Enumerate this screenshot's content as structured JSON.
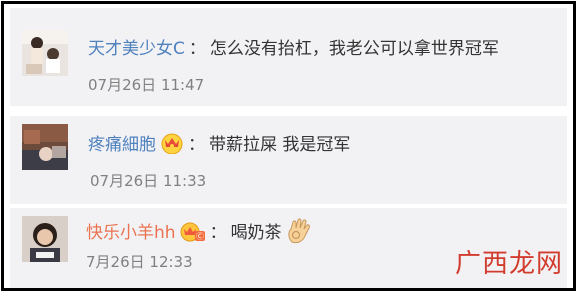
{
  "comments": [
    {
      "user": "天才美少女C",
      "separator": "：",
      "text": "怎么没有抬杠，我老公可以拿世界冠军",
      "time": "07月26日 11:47",
      "badge": null
    },
    {
      "user": "疼痛細胞",
      "separator": "：",
      "text": "带薪拉屎 我是冠军",
      "time": "07月26日 11:33",
      "badge": "crown-icon"
    },
    {
      "user": "快乐小羊hh",
      "separator": "：",
      "text": "喝奶茶",
      "time": "7月26日 12:33",
      "badge": "member-badge-icon"
    }
  ],
  "watermark": "广西龙网",
  "colors": {
    "username_blue": "#4f81bd",
    "username_orange": "#eb7350",
    "timestamp_gray": "#808080",
    "watermark_red": "#d23c2e"
  }
}
